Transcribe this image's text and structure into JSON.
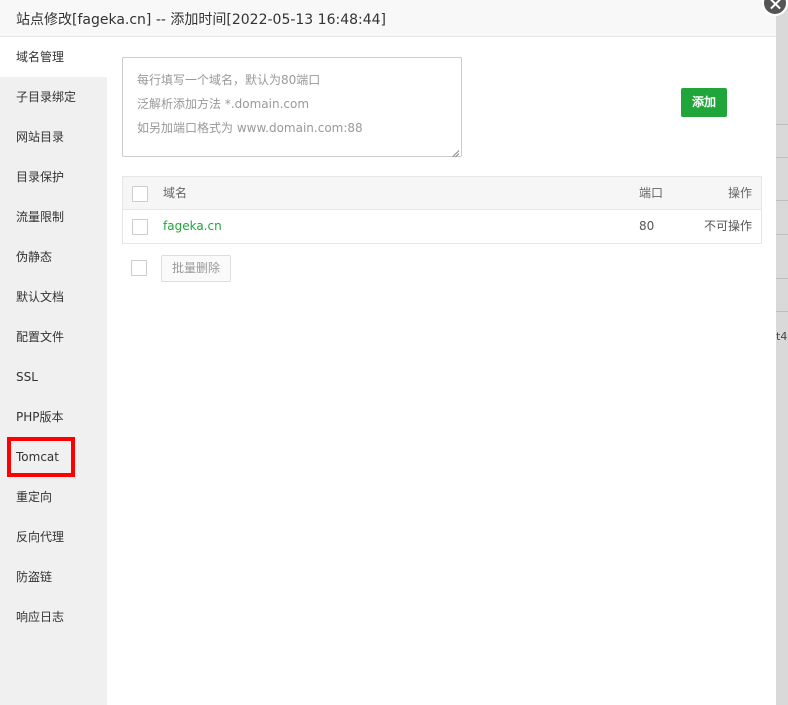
{
  "dialog": {
    "title": "站点修改[fageka.cn] -- 添加时间[2022-05-13 16:48:44]"
  },
  "sidebar": {
    "items": [
      {
        "label": "域名管理"
      },
      {
        "label": "子目录绑定"
      },
      {
        "label": "网站目录"
      },
      {
        "label": "目录保护"
      },
      {
        "label": "流量限制"
      },
      {
        "label": "伪静态"
      },
      {
        "label": "默认文档"
      },
      {
        "label": "配置文件"
      },
      {
        "label": "SSL"
      },
      {
        "label": "PHP版本"
      },
      {
        "label": "Tomcat"
      },
      {
        "label": "重定向"
      },
      {
        "label": "反向代理"
      },
      {
        "label": "防盗链"
      },
      {
        "label": "响应日志"
      }
    ],
    "active_index": 0,
    "highlighted_index": 10,
    "highlight_color": "#ff0000"
  },
  "domain_input": {
    "placeholder_lines": [
      "每行填写一个域名，默认为80端口",
      "泛解析添加方法 *.domain.com",
      "如另加端口格式为 www.domain.com:88"
    ],
    "value": ""
  },
  "add_button": {
    "label": "添加",
    "color": "#20a53a"
  },
  "table": {
    "headers": {
      "name": "域名",
      "port": "端口",
      "ops": "操作"
    },
    "rows": [
      {
        "name": "fageka.cn",
        "port": "80",
        "ops": "不可操作"
      }
    ]
  },
  "batch_delete": {
    "label": "批量删除"
  },
  "background": {
    "fragment": "t4"
  },
  "icons": {
    "close": "close-icon",
    "resize": "resize-grip-icon"
  }
}
